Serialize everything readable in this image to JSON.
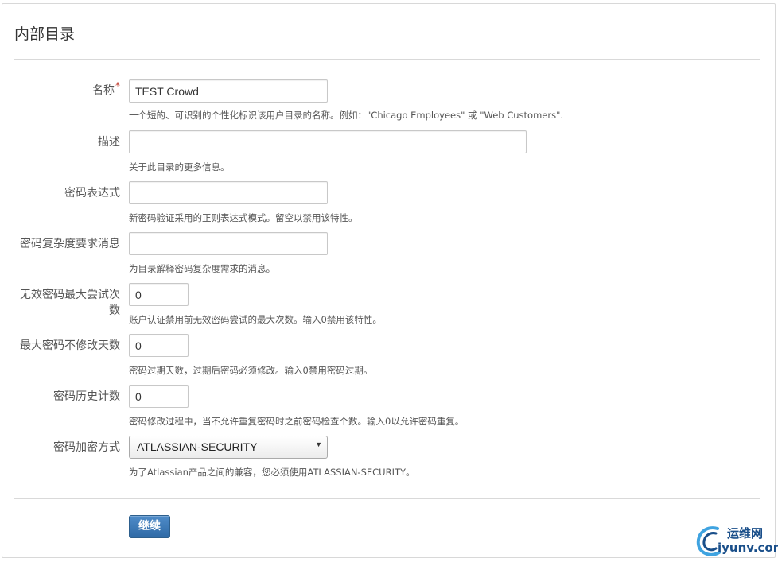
{
  "page_title": "内部目录",
  "fields": {
    "name": {
      "label": "名称",
      "required_mark": "*",
      "value": "TEST Crowd",
      "help": "一个短的、可识别的个性化标识该用户目录的名称。例如：\"Chicago Employees\" 或 \"Web Customers\"."
    },
    "description": {
      "label": "描述",
      "value": "",
      "help": "关于此目录的更多信息。"
    },
    "password_regex": {
      "label": "密码表达式",
      "value": "",
      "help": "新密码验证采用的正则表达式模式。留空以禁用该特性。"
    },
    "password_complexity_message": {
      "label": "密码复杂度要求消息",
      "value": "",
      "help": "为目录解释密码复杂度需求的消息。"
    },
    "max_invalid_attempts": {
      "label": "无效密码最大尝试次数",
      "value": "0",
      "help": "账户认证禁用前无效密码尝试的最大次数。输入0禁用该特性。"
    },
    "max_password_age": {
      "label": "最大密码不修改天数",
      "value": "0",
      "help": "密码过期天数，过期后密码必须修改。输入0禁用密码过期。"
    },
    "password_history_count": {
      "label": "密码历史计数",
      "value": "0",
      "help": "密码修改过程中，当不允许重复密码时之前密码检查个数。输入0以允许密码重复。"
    },
    "password_encryption": {
      "label": "密码加密方式",
      "selected": "ATLASSIAN-SECURITY",
      "help": "为了Atlassian产品之间的兼容，您必须使用ATLASSIAN-SECURITY。"
    }
  },
  "continue_button": "继续",
  "watermark": {
    "line1": "运维网",
    "line2": "iyunv.com"
  },
  "colors": {
    "primary_button": "#3a78b8",
    "required": "#c0392b",
    "watermark": "#1a4f8a"
  }
}
